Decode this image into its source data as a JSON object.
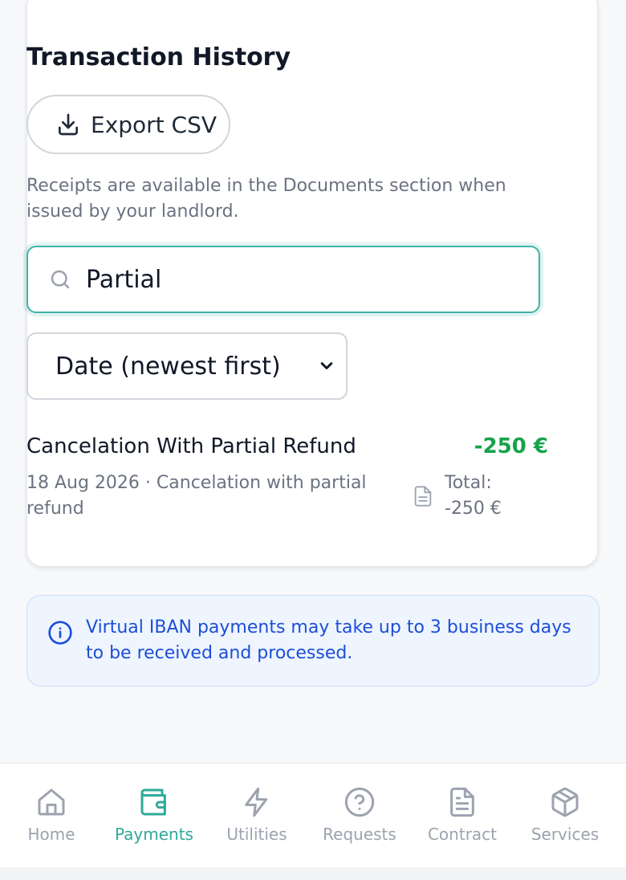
{
  "colors": {
    "accent": "#2fa99b",
    "amount_negative": "#16a34a",
    "info_text": "#1d4ed8",
    "info_background": "#eef5ff"
  },
  "transactions": {
    "title": "Transaction History",
    "export_label": "Export CSV",
    "export_icon": "download-icon",
    "notice": "Receipts are available in the Documents section when issued by your landlord.",
    "search": {
      "value": "Partial",
      "icon": "search-icon"
    },
    "sort": {
      "selected": "Date (newest first)"
    },
    "items": [
      {
        "title": "Cancelation With Partial Refund",
        "amount": "-250 €",
        "subtitle": "18 Aug 2026 · Cancelation with partial refund",
        "total_label": "Total:",
        "total_value": "-250 €",
        "icon": "document-icon"
      }
    ]
  },
  "info": {
    "icon": "info-icon",
    "text": "Virtual IBAN payments may take up to 3 business days to be received and processed."
  },
  "nav": {
    "items": [
      {
        "label": "Home",
        "icon": "home-icon",
        "active": false
      },
      {
        "label": "Payments",
        "icon": "wallet-icon",
        "active": true
      },
      {
        "label": "Utilities",
        "icon": "lightning-icon",
        "active": false
      },
      {
        "label": "Requests",
        "icon": "question-circle-icon",
        "active": false
      },
      {
        "label": "Contract",
        "icon": "file-text-icon",
        "active": false
      },
      {
        "label": "Services",
        "icon": "package-icon",
        "active": false
      }
    ]
  }
}
